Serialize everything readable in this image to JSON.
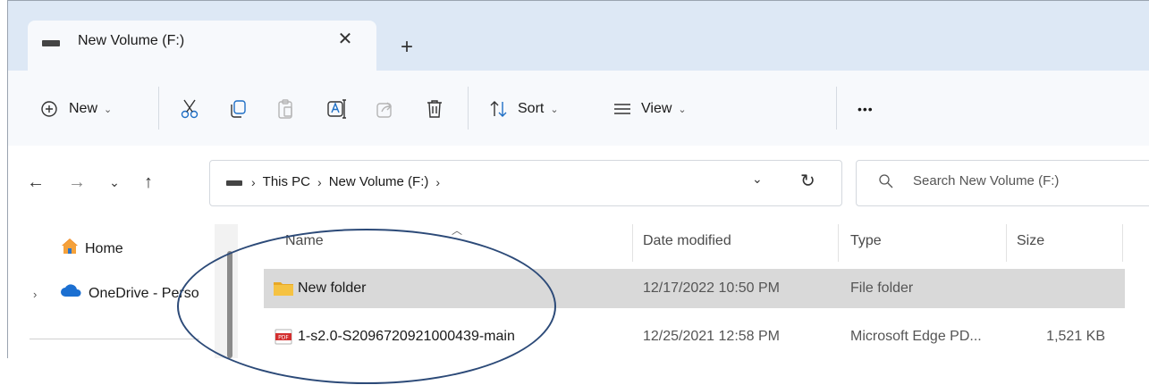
{
  "tab": {
    "title": "New Volume (F:)",
    "close_glyph": "✕",
    "new_tab_glyph": "+"
  },
  "toolbar": {
    "new_label": "New",
    "sort_label": "Sort",
    "view_label": "View",
    "more_glyph": "•••",
    "chevron": "⌄"
  },
  "address": {
    "crumbs": [
      "This PC",
      "New Volume (F:)"
    ],
    "separator": "›"
  },
  "search": {
    "placeholder": "Search New Volume (F:)"
  },
  "navpane": {
    "items": [
      {
        "label": "Home",
        "icon": "home-icon"
      },
      {
        "label": "OneDrive - Perso",
        "icon": "onedrive-icon"
      }
    ]
  },
  "columns": {
    "name": "Name",
    "date": "Date modified",
    "type": "Type",
    "size": "Size"
  },
  "files": [
    {
      "name": "New folder",
      "date": "12/17/2022 10:50 PM",
      "type": "File folder",
      "size": "",
      "icon": "folder-icon",
      "selected": true
    },
    {
      "name": "1-s2.0-S2096720921000439-main",
      "date": "12/25/2021 12:58 PM",
      "type": "Microsoft Edge PD...",
      "size": "1,521 KB",
      "icon": "pdf-icon",
      "selected": false
    }
  ],
  "colors": {
    "tabstrip": "#dde8f5",
    "toolbar": "#f7f9fc",
    "selected_row": "#d9d9d9",
    "annotation": "#2c4a78",
    "folder": "#f5c242",
    "pdf": "#d32f2f"
  }
}
